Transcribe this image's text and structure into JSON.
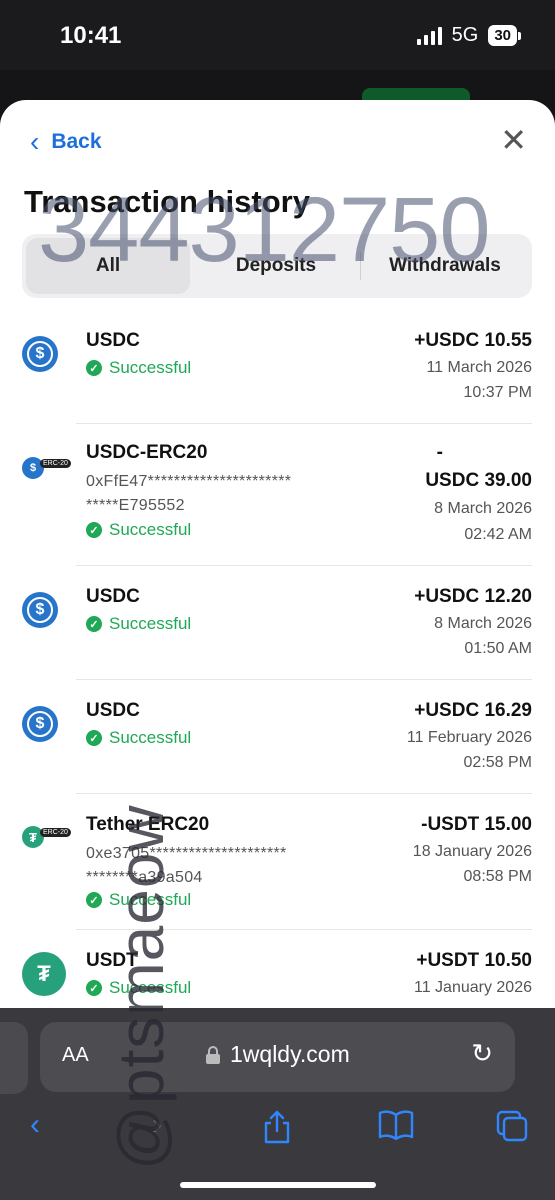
{
  "status_bar": {
    "time": "10:41",
    "network": "5G",
    "battery": "30"
  },
  "header": {
    "back_label": "Back",
    "close_icon": "close-icon",
    "title": "Transaction history"
  },
  "tabs": [
    {
      "label": "All"
    },
    {
      "label": "Deposits"
    },
    {
      "label": "Withdrawals"
    }
  ],
  "transactions": [
    {
      "name": "USDC",
      "status": "Successful",
      "amount": "+USDC 10.55",
      "date": "11 March 2026",
      "time": "10:37 PM",
      "icon": "usdc-icon"
    },
    {
      "name": "USDC-ERC20",
      "address": "0xFfE47**********************\n*****E795552",
      "status": "Successful",
      "amount_sign": "-",
      "amount": "USDC 39.00",
      "date": "8 March 2026",
      "time": "02:42 AM",
      "icon": "usdc-erc20-icon",
      "badge": "ERC-20"
    },
    {
      "name": "USDC",
      "status": "Successful",
      "amount": "+USDC 12.20",
      "date": "8 March 2026",
      "time": "01:50 AM",
      "icon": "usdc-icon"
    },
    {
      "name": "USDC",
      "status": "Successful",
      "amount": "+USDC 16.29",
      "date": "11 February 2026",
      "time": "02:58 PM",
      "icon": "usdc-icon"
    },
    {
      "name": "Tether ERC20",
      "address": "0xe3705*********************\n********a39a504",
      "status": "Successful",
      "amount": "-USDT 15.00",
      "date": "18 January 2026",
      "time": "08:58 PM",
      "icon": "tether-erc20-icon",
      "badge": "ERC-20"
    },
    {
      "name": "USDT",
      "status": "Successful",
      "amount": "+USDT 10.50",
      "date": "11 January 2026",
      "icon": "tether-icon"
    }
  ],
  "browser": {
    "text_size_label": "AA",
    "url": "1wqldy.com"
  },
  "watermarks": {
    "number": "344312750",
    "handle": "@ptsmaeow"
  }
}
